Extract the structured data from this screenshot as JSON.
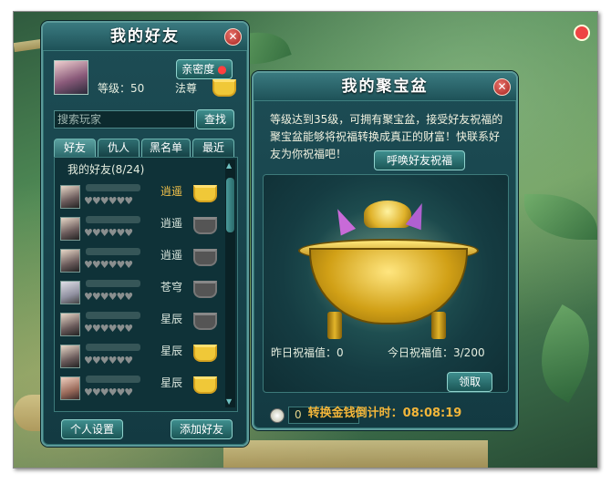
{
  "friends_panel": {
    "title": "我的好友",
    "close_icon": "close-icon",
    "intimacy_button": "亲密度",
    "level_text": "等级：50",
    "class_text": "法尊",
    "search_placeholder": "搜索玩家",
    "search_button": "查找",
    "tabs": [
      {
        "label": "好友",
        "active": true
      },
      {
        "label": "仇人",
        "active": false
      },
      {
        "label": "黑名单",
        "active": false
      },
      {
        "label": "最近",
        "active": false
      }
    ],
    "group_label": "我的好友(8/24)",
    "rows": [
      {
        "name": "逍遥",
        "highlight": true,
        "pot": "gold"
      },
      {
        "name": "逍遥",
        "highlight": false,
        "pot": "grey"
      },
      {
        "name": "逍遥",
        "highlight": false,
        "pot": "grey"
      },
      {
        "name": "苍穹",
        "highlight": false,
        "pot": "grey"
      },
      {
        "name": "星辰",
        "highlight": false,
        "pot": "grey"
      },
      {
        "name": "星辰",
        "highlight": false,
        "pot": "gold"
      },
      {
        "name": "星辰",
        "highlight": false,
        "pot": "gold"
      }
    ],
    "settings_button": "个人设置",
    "add_friend_button": "添加好友"
  },
  "basin_panel": {
    "title": "我的聚宝盆",
    "description": "等级达到35级，可拥有聚宝盆，接受好友祝福的聚宝盆能够将祝福转换成真正的财富！快联系好友为你祝福吧！",
    "call_button": "呼唤好友祝福",
    "yesterday_label": "昨日祝福值：0",
    "today_label": "今日祝福值：3/200",
    "coin_value": "0",
    "claim_button": "领取",
    "countdown_label": "转换金钱倒计时：",
    "countdown_value": "08:08:19"
  },
  "colors": {
    "gold": "#f3c24a",
    "panel": "#1d4d55",
    "accent": "#f3b63a"
  }
}
